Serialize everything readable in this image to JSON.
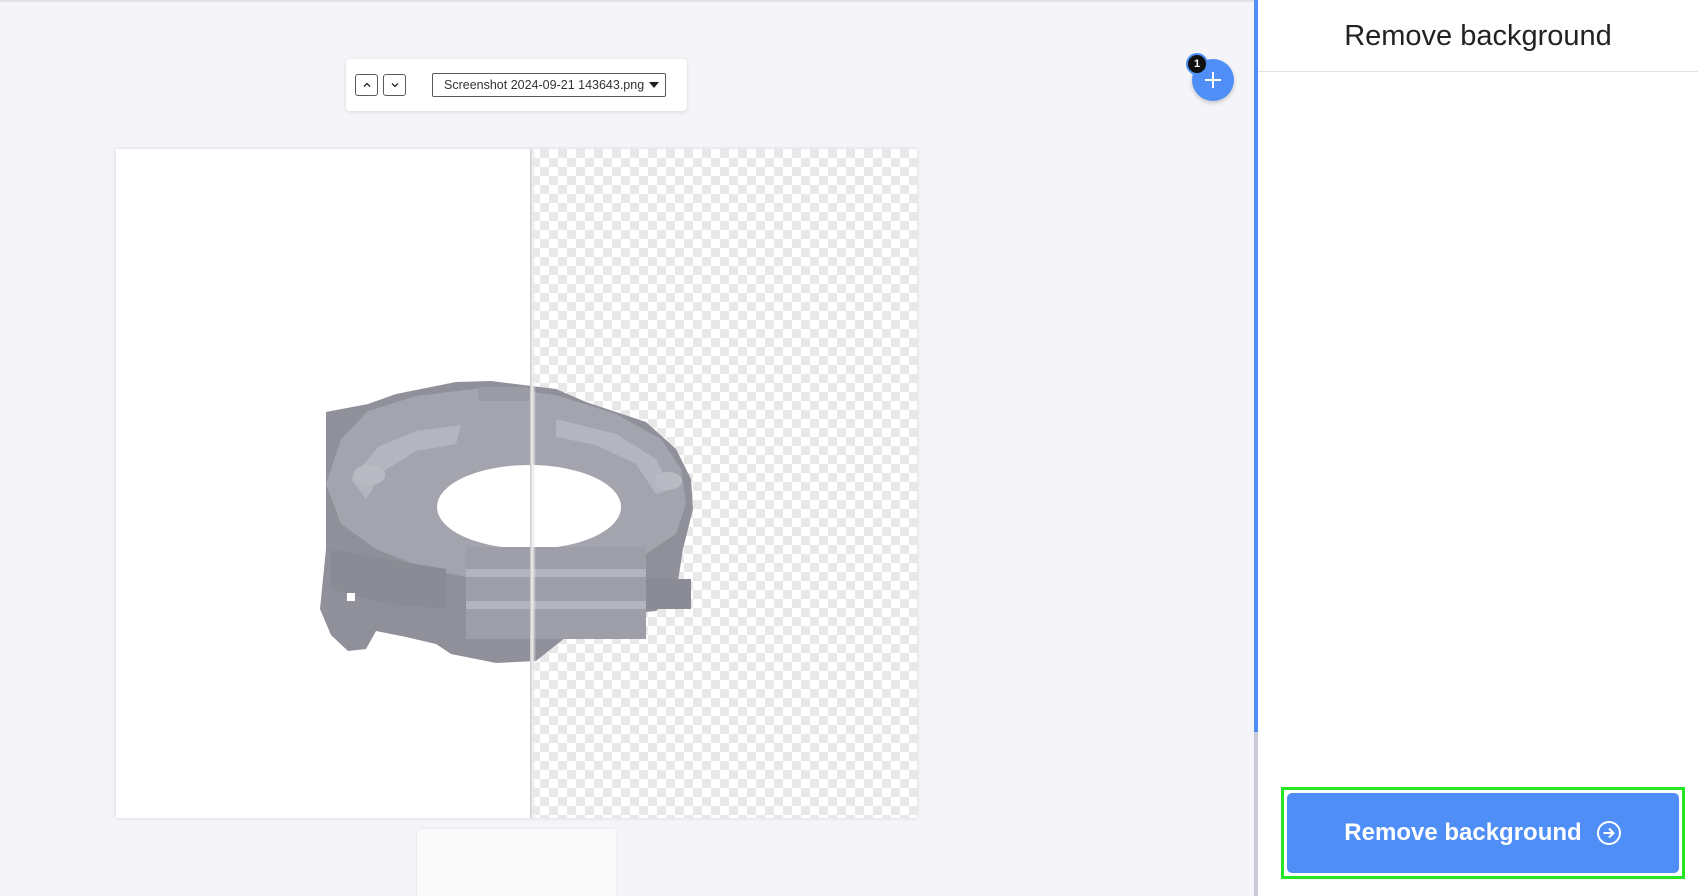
{
  "editor": {
    "file_select": {
      "value": "Screenshot 2024-09-21 143643.png"
    },
    "image_count": "1",
    "icons": {
      "prev": "chevron-up-icon",
      "next": "chevron-down-icon",
      "add": "plus-icon",
      "dropdown": "caret-down-icon"
    }
  },
  "panel": {
    "title": "Remove background",
    "primary_button": {
      "label": "Remove background",
      "icon": "arrow-right-circle-icon"
    }
  },
  "colors": {
    "accent": "#4f8ef7",
    "focus": "#25e625",
    "object": "#8f9099"
  }
}
